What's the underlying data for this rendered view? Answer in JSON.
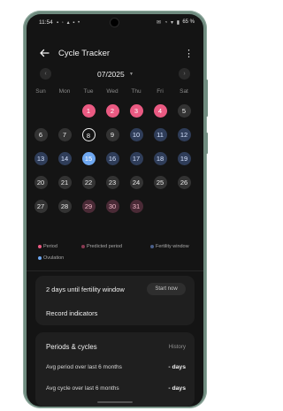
{
  "status_bar": {
    "time": "11:54",
    "left_icons": "▪ ◦ ▴ ▪ •",
    "right_icons": "✉ ◔ ▾ ▮",
    "battery": "65 %"
  },
  "header": {
    "title": "Cycle Tracker"
  },
  "calendar": {
    "month_label": "07/2025",
    "weekdays": [
      "Sun",
      "Mon",
      "Tue",
      "Wed",
      "Thu",
      "Fri",
      "Sat"
    ],
    "weeks": [
      [
        null,
        null,
        {
          "d": "1",
          "t": "period"
        },
        {
          "d": "2",
          "t": "period"
        },
        {
          "d": "3",
          "t": "period"
        },
        {
          "d": "4",
          "t": "period"
        },
        {
          "d": "5",
          "t": "normal"
        }
      ],
      [
        {
          "d": "6",
          "t": "normal"
        },
        {
          "d": "7",
          "t": "normal"
        },
        {
          "d": "8",
          "t": "today"
        },
        {
          "d": "9",
          "t": "normal"
        },
        {
          "d": "10",
          "t": "fertile"
        },
        {
          "d": "11",
          "t": "fertile"
        },
        {
          "d": "12",
          "t": "fertile"
        }
      ],
      [
        {
          "d": "13",
          "t": "fertile"
        },
        {
          "d": "14",
          "t": "fertile"
        },
        {
          "d": "15",
          "t": "ovulation"
        },
        {
          "d": "16",
          "t": "fertile"
        },
        {
          "d": "17",
          "t": "fertile"
        },
        {
          "d": "18",
          "t": "fertile"
        },
        {
          "d": "19",
          "t": "fertile"
        }
      ],
      [
        {
          "d": "20",
          "t": "normal"
        },
        {
          "d": "21",
          "t": "normal"
        },
        {
          "d": "22",
          "t": "normal"
        },
        {
          "d": "23",
          "t": "normal"
        },
        {
          "d": "24",
          "t": "normal"
        },
        {
          "d": "25",
          "t": "normal"
        },
        {
          "d": "26",
          "t": "normal"
        }
      ],
      [
        {
          "d": "27",
          "t": "normal"
        },
        {
          "d": "28",
          "t": "normal"
        },
        {
          "d": "29",
          "t": "predicted"
        },
        {
          "d": "30",
          "t": "predicted"
        },
        {
          "d": "31",
          "t": "predicted"
        },
        null,
        null
      ]
    ]
  },
  "legend": {
    "period": "Period",
    "predicted": "Predicted period",
    "fertility": "Fertility window",
    "ovulation": "Ovulation"
  },
  "fertility_card": {
    "text": "2 days until fertility window",
    "button": "Start now",
    "record": "Record indicators"
  },
  "cycles_card": {
    "title": "Periods & cycles",
    "history": "History",
    "stats": [
      {
        "label": "Avg period over last 6 months",
        "value": "- days"
      },
      {
        "label": "Avg cycle over last 6 months",
        "value": "- days"
      }
    ]
  },
  "colors": {
    "period": "#ea5a82",
    "predicted": "#4a2a36",
    "fertile": "#2f3d59",
    "ovulation": "#6ea7f0",
    "frame": "#6f8b7f"
  }
}
